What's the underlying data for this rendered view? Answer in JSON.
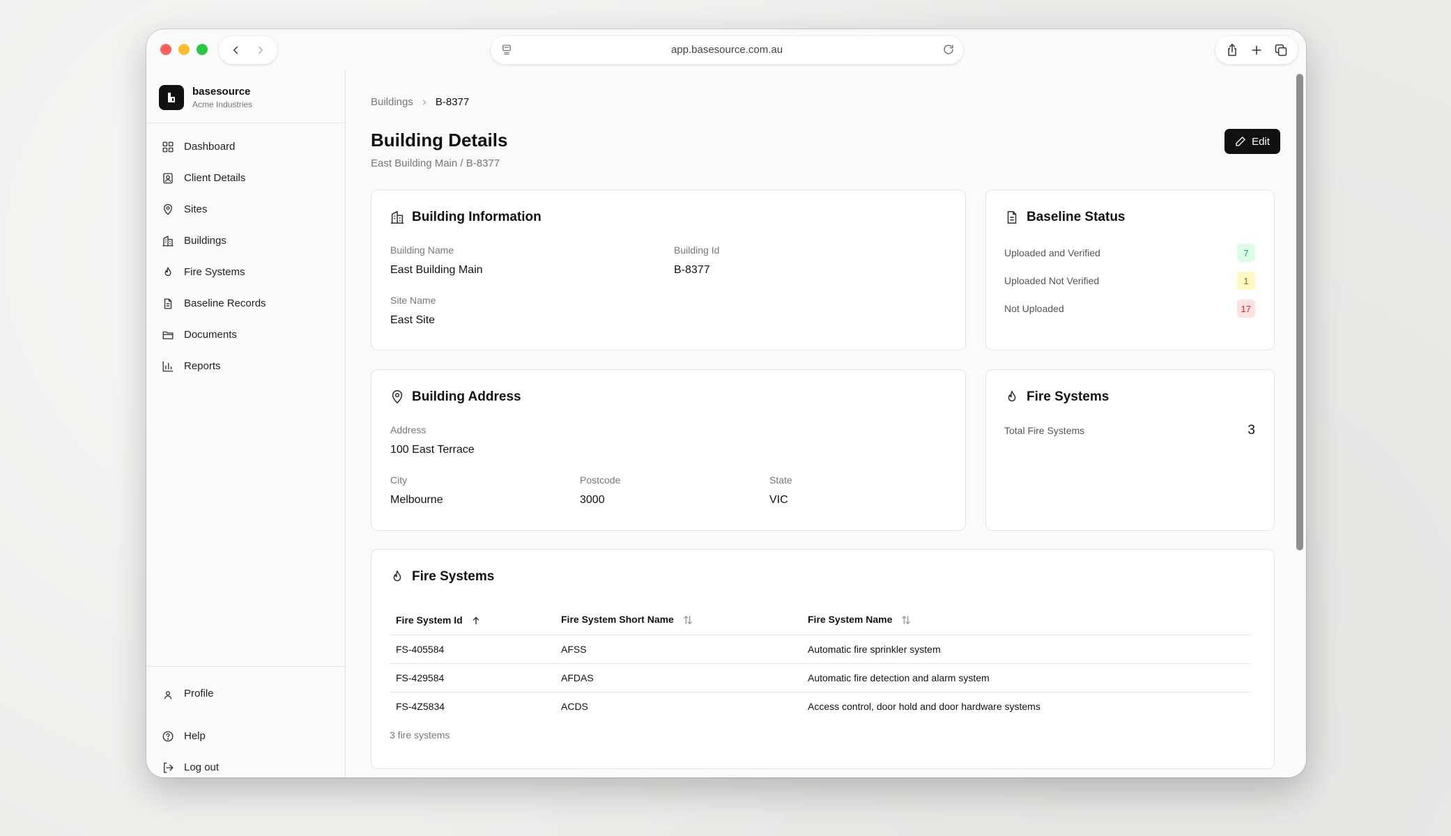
{
  "browser": {
    "url": "app.basesource.com.au"
  },
  "brand": {
    "name": "basesource",
    "org": "Acme Industries"
  },
  "sidebar": {
    "items": [
      {
        "label": "Dashboard",
        "icon": "dashboard-icon"
      },
      {
        "label": "Client Details",
        "icon": "client-icon"
      },
      {
        "label": "Sites",
        "icon": "map-pin-icon"
      },
      {
        "label": "Buildings",
        "icon": "building-icon"
      },
      {
        "label": "Fire Systems",
        "icon": "flame-icon"
      },
      {
        "label": "Baseline Records",
        "icon": "file-text-icon"
      },
      {
        "label": "Documents",
        "icon": "folder-icon"
      },
      {
        "label": "Reports",
        "icon": "bar-chart-icon"
      }
    ],
    "bottom_items": [
      {
        "label": "Profile",
        "icon": "user-icon"
      },
      {
        "label": "Help",
        "icon": "help-circle-icon"
      },
      {
        "label": "Log out",
        "icon": "logout-icon"
      }
    ]
  },
  "breadcrumb": {
    "parent": "Buildings",
    "current": "B-8377"
  },
  "page": {
    "title": "Building Details",
    "subtitle": "East Building Main / B-8377",
    "edit_label": "Edit"
  },
  "building_info": {
    "title": "Building Information",
    "building_name_label": "Building Name",
    "building_name": "East Building Main",
    "building_id_label": "Building Id",
    "building_id": "B-8377",
    "site_name_label": "Site Name",
    "site_name": "East Site"
  },
  "baseline_status": {
    "title": "Baseline Status",
    "rows": [
      {
        "label": "Uploaded and Verified",
        "count": "7",
        "color": "#16a34a",
        "bg": "#dcfce7"
      },
      {
        "label": "Uploaded Not Verified",
        "count": "1",
        "color": "#a16207",
        "bg": "#fef9c3"
      },
      {
        "label": "Not Uploaded",
        "count": "17",
        "color": "#dc2626",
        "bg": "#fee2e2"
      }
    ]
  },
  "address": {
    "title": "Building Address",
    "address_label": "Address",
    "address": "100 East Terrace",
    "city_label": "City",
    "city": "Melbourne",
    "postcode_label": "Postcode",
    "postcode": "3000",
    "state_label": "State",
    "state": "VIC"
  },
  "fire_summary": {
    "title": "Fire Systems",
    "total_label": "Total Fire Systems",
    "total": "3"
  },
  "fire_table": {
    "title": "Fire Systems",
    "columns": [
      "Fire System Id",
      "Fire System Short Name",
      "Fire System Name"
    ],
    "rows": [
      {
        "id": "FS-405584",
        "short": "AFSS",
        "name": "Automatic fire sprinkler system"
      },
      {
        "id": "FS-429584",
        "short": "AFDAS",
        "name": "Automatic fire detection and alarm system"
      },
      {
        "id": "FS-4Z5834",
        "short": "ACDS",
        "name": "Access control, door hold and door hardware systems"
      }
    ],
    "footer": "3 fire systems"
  }
}
